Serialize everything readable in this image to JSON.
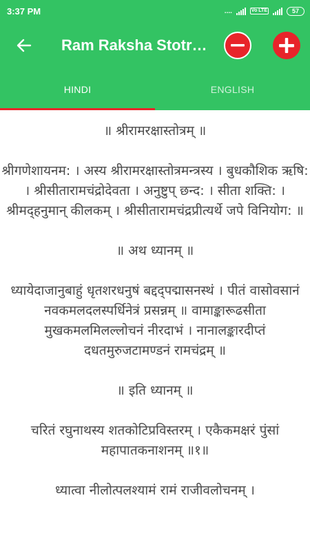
{
  "status_bar": {
    "time": "3:37 PM",
    "dots": "....",
    "volte": "Vo LTE",
    "battery": "57"
  },
  "app_bar": {
    "title": "Ram Raksha Stotram",
    "back_icon": "arrow-left-icon",
    "zoom_out_icon": "minus-circle-icon",
    "zoom_in_icon": "plus-circle-icon"
  },
  "tabs": [
    {
      "label": "HINDI",
      "selected": true
    },
    {
      "label": "ENGLISH",
      "selected": false
    }
  ],
  "colors": {
    "primary": "#33c363",
    "accent": "#e8242a",
    "text": "#4a4a4a"
  },
  "content": {
    "verses": [
      "॥ श्रीरामरक्षास्तोत्रम् ॥",
      "श्रीगणेशायनम: । अस्य श्रीरामरक्षास्तोत्रमन्त्रस्य । बुधकौशिक ऋषि: । श्रीसीतारामचंद्रोदेवता । अनुष्टुप् छन्द: । सीता शक्ति: । श्रीमद्हनुमान् कीलकम् । श्रीसीतारामचंद्रप्रीत्यर्थे जपे विनियोग: ॥",
      "॥ अथ ध्यानम् ॥",
      "ध्यायेदाजानुबाहुं धृतशरधनुषं बद्दद्पद्मासनस्थं । पीतं वासोवसानं नवकमलदलस्पर्धिनेत्रं प्रसन्नम् ॥ वामाङ्कारूढसीता मुखकमलमिलल्लोचनं नीरदाभं । नानालङ्कारदीप्तं दधतमुरुजटामण्डनं रामचंद्रम् ॥",
      "॥ इति ध्यानम् ॥",
      "चरितं रघुनाथस्य शतकोटिप्रविस्तरम् । एकैकमक्षरं पुंसां महापातकनाशनम् ॥१॥",
      "ध्यात्वा नीलोत्पलश्यामं रामं राजीवलोचनम् ।"
    ]
  }
}
